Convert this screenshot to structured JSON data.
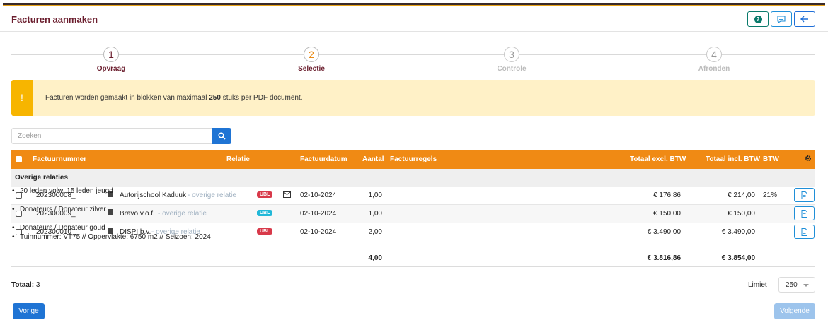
{
  "header": {
    "title": "Facturen aanmaken",
    "buttons": {
      "help": "help-icon",
      "feedback": "chat-icon",
      "back": "arrow-left-icon"
    }
  },
  "steps": [
    {
      "number": "1",
      "label": "Opvraag",
      "state": "done"
    },
    {
      "number": "2",
      "label": "Selectie",
      "state": "active"
    },
    {
      "number": "3",
      "label": "Controle",
      "state": "todo"
    },
    {
      "number": "4",
      "label": "Afronden",
      "state": "todo"
    }
  ],
  "alert": {
    "icon": "!",
    "text_before": "Facturen worden gemaakt in blokken van maximaal ",
    "text_bold": "250",
    "text_after": " stuks per PDF document."
  },
  "search": {
    "placeholder": "Zoeken",
    "value": ""
  },
  "table": {
    "columns": {
      "factuurnummer": "Factuurnummer",
      "relatie": "Relatie",
      "factuurdatum": "Factuurdatum",
      "aantal": "Aantal",
      "factuurregels": "Factuurregels",
      "totaal_excl": "Totaal excl. BTW",
      "totaal_incl": "Totaal incl. BTW",
      "btw": "BTW"
    },
    "group_label": "Overige relaties",
    "rows": [
      {
        "factuurnummer": "202300008_",
        "relatie": "Autorijschool Kaduuk",
        "relatie_note": "- overige relatie",
        "ubl": "UBL",
        "ubl_color": "#d8394a",
        "email_icon": true,
        "factuurdatum": "02-10-2024",
        "aantal": "1,00",
        "regels": [
          "20 leden volw, 15 leden jeugd"
        ],
        "totaal_excl": "€ 176,86",
        "totaal_incl": "€ 214,00",
        "btw": "21%"
      },
      {
        "factuurnummer": "202300009_",
        "relatie": "Bravo v.o.f.",
        "relatie_note": "- overige relatie",
        "ubl": "UBL",
        "ubl_color": "#22b8d8",
        "email_icon": false,
        "factuurdatum": "02-10-2024",
        "aantal": "1,00",
        "regels": [
          "Donateurs / Donateur zilver"
        ],
        "totaal_excl": "€ 150,00",
        "totaal_incl": "€ 150,00",
        "btw": ""
      },
      {
        "factuurnummer": "202300010_",
        "relatie": "DISPI b.v.",
        "relatie_note": "- overige relatie",
        "ubl": "UBL",
        "ubl_color": "#d8394a",
        "email_icon": false,
        "factuurdatum": "02-10-2024",
        "aantal": "2,00",
        "regels": [
          "Donateurs / Donateur goud",
          "Tuinnummer: VT75 // Oppervlakte: 6750 m2 // Seizoen: 2024"
        ],
        "totaal_excl": "€ 3.490,00",
        "totaal_incl": "€ 3.490,00",
        "btw": ""
      }
    ],
    "footer": {
      "aantal": "4,00",
      "totaal_excl": "€ 3.816,86",
      "totaal_incl": "€ 3.854,00"
    }
  },
  "summary": {
    "totaal_label": "Totaal:",
    "totaal_value": "3",
    "limiet_label": "Limiet",
    "limiet_value": "250"
  },
  "nav": {
    "prev_label": "Vorige",
    "next_label": "Volgende"
  },
  "colors": {
    "accent": "#f08a14",
    "primary": "#1f74d4",
    "title": "#6b1e2e",
    "alert_bg": "#fff1c7",
    "alert_bar": "#f7b500"
  }
}
